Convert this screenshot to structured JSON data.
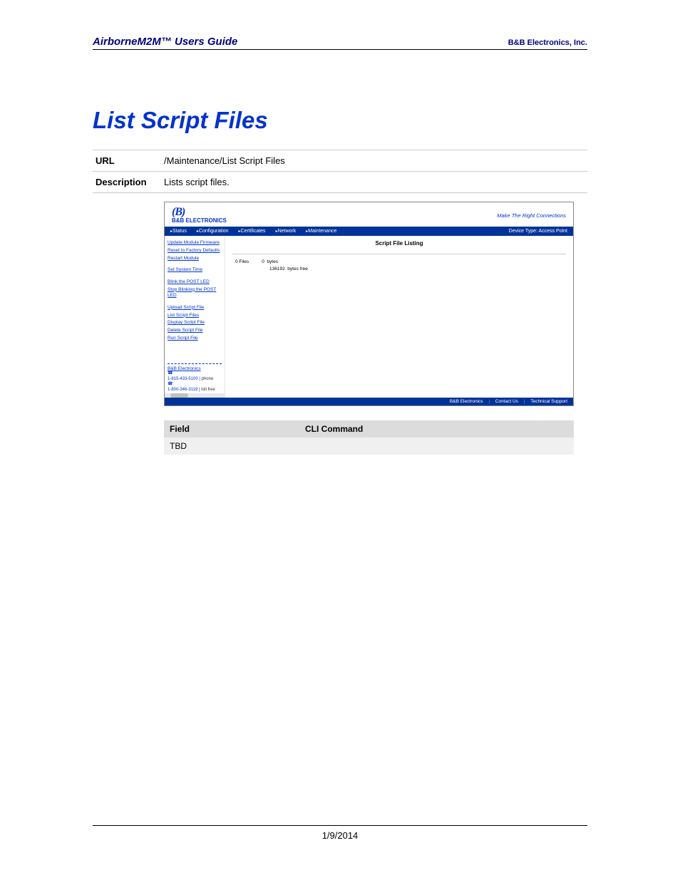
{
  "doc": {
    "header_left": "AirborneM2M™ Users Guide",
    "header_right": "B&B Electronics, Inc.",
    "title": "List Script Files",
    "meta": {
      "url_label": "URL",
      "url_value": "/Maintenance/List Script Files",
      "desc_label": "Description",
      "desc_value": "Lists script files."
    },
    "footer_date": "1/9/2014"
  },
  "screenshot": {
    "logo_b": "(B)",
    "logo_text": "B&B ELECTRONICS",
    "tagline": "Make The Right Connections",
    "tabs": {
      "status": "Status",
      "configuration": "Configuration",
      "certificates": "Certificates",
      "network": "Network",
      "maintenance": "Maintenance"
    },
    "device_type": "Device Type: Access Point",
    "sidebar": {
      "g1": {
        "update_firmware": "Update Module Firmware",
        "reset_defaults": "Reset to Factory Defaults",
        "restart_module": "Restart Module"
      },
      "g2": {
        "set_system_time": "Set System Time"
      },
      "g3": {
        "blink_post_led": "Blink the POST LED",
        "stop_blink_post_led": "Stop Blinking the POST LED"
      },
      "g4": {
        "upload_script": "Upload Script File",
        "list_script": "List Script Files",
        "display_script": "Display Script File",
        "delete_script": "Delete Script File",
        "run_script": "Run Script File"
      },
      "footer": {
        "company": "B&B Electronics",
        "phone1_num": "1-815-433-5100  |",
        "phone1_lbl": "phone",
        "phone2_num": "1-800-346-3119  |",
        "phone2_lbl": "toll free"
      }
    },
    "main": {
      "title": "Script File Listing",
      "stats_line1": "0 Files          0  bytes",
      "stats_line2": "136192  bytes free"
    },
    "footer": {
      "company": "B&B Electronics",
      "contact": "Contact Us",
      "support": "Technical Support",
      "sep": "|"
    }
  },
  "cmd_table": {
    "field_hdr": "Field",
    "cli_hdr": "CLI Command",
    "row1_field": "TBD",
    "row1_cli": ""
  }
}
